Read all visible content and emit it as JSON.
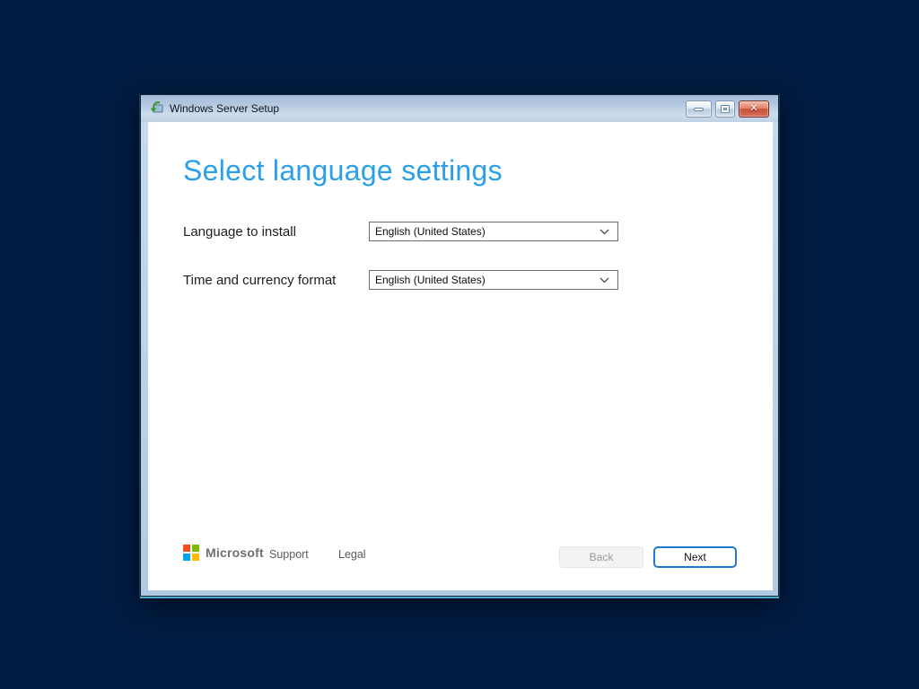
{
  "window": {
    "title": "Windows Server Setup",
    "icons": {
      "app": "windows-setup-icon",
      "minimize": "minimize-icon",
      "maximize": "maximize-icon",
      "close": "close-icon",
      "close_glyph": "✕"
    }
  },
  "page": {
    "heading": "Select language settings",
    "fields": [
      {
        "label": "Language to install",
        "value": "English (United States)",
        "icon": "chevron-down-icon"
      },
      {
        "label": "Time and currency format",
        "value": "English (United States)",
        "icon": "chevron-down-icon"
      }
    ]
  },
  "footer": {
    "brand": "Microsoft",
    "links": [
      {
        "label": "Support"
      },
      {
        "label": "Legal"
      }
    ],
    "back_label": "Back",
    "next_label": "Next"
  },
  "colors": {
    "desktop_background": "#001b41",
    "titlebar_blue": "#bcd0e5",
    "heading_blue": "#2b9fe8",
    "next_button_border": "#2579cd",
    "close_button_red": "#c85138",
    "ms_logo_red": "#f25022",
    "ms_logo_green": "#7fba00",
    "ms_logo_blue": "#00a4ef",
    "ms_logo_yellow": "#ffb900"
  }
}
